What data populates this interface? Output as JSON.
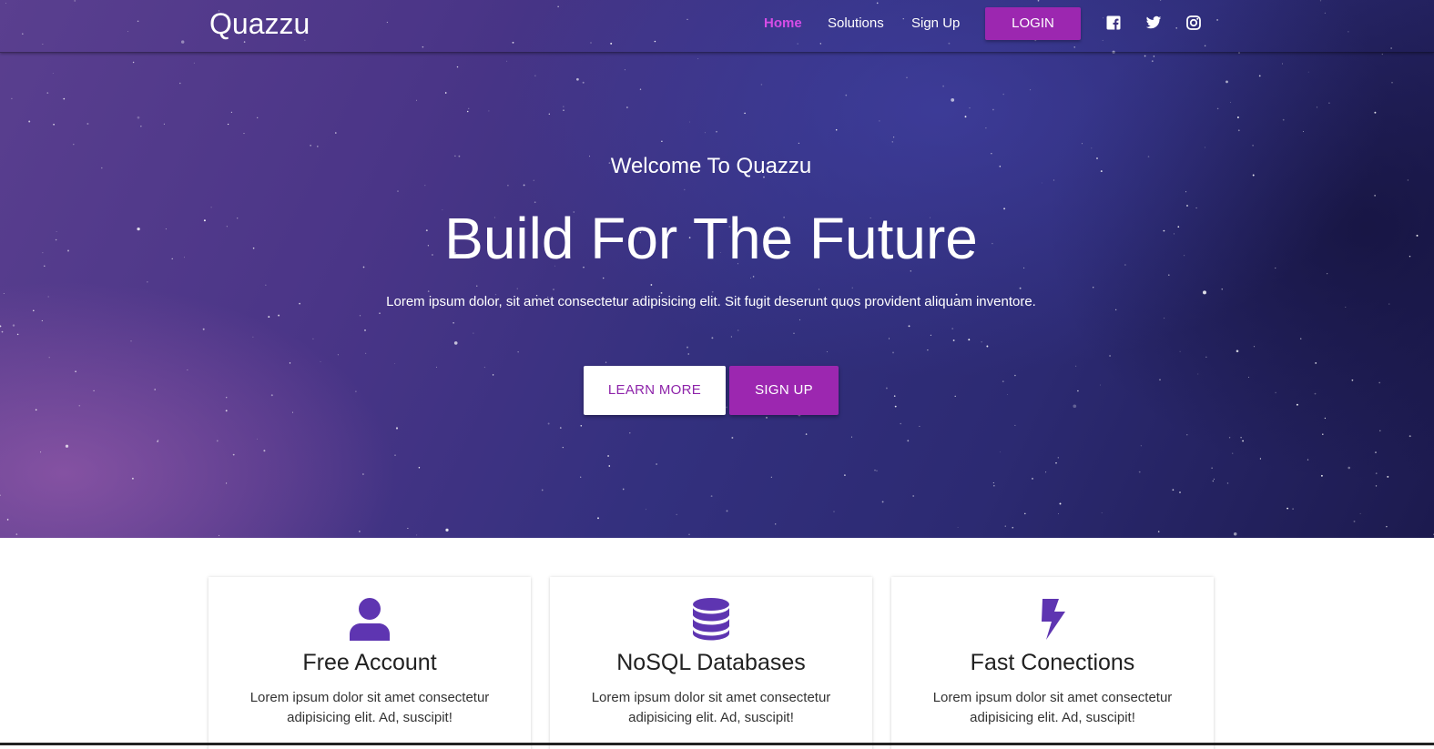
{
  "colors": {
    "accent": "#9c27b0",
    "active_nav": "#d54ce6",
    "icon": "#5e35b1",
    "hero_text": "#ffffff"
  },
  "navbar": {
    "brand": "Quazzu",
    "links": [
      {
        "label": "Home",
        "active": true
      },
      {
        "label": "Solutions",
        "active": false
      },
      {
        "label": "Sign Up",
        "active": false
      }
    ],
    "login_label": "LOGIN",
    "social_icons": [
      "facebook-icon",
      "twitter-icon",
      "instagram-icon"
    ]
  },
  "hero": {
    "welcome": "Welcome To Quazzu",
    "headline": "Build For The Future",
    "tagline": "Lorem ipsum dolor, sit amet consectetur adipisicing elit. Sit fugit deserunt quos provident aliquam inventore.",
    "learn_more_label": "LEARN MORE",
    "sign_up_label": "SIGN UP"
  },
  "features": [
    {
      "icon": "user-icon",
      "title": "Free Account",
      "text": "Lorem ipsum dolor sit amet consectetur adipisicing elit. Ad, suscipit!"
    },
    {
      "icon": "database-icon",
      "title": "NoSQL Databases",
      "text": "Lorem ipsum dolor sit amet consectetur adipisicing elit. Ad, suscipit!"
    },
    {
      "icon": "bolt-icon",
      "title": "Fast Conections",
      "text": "Lorem ipsum dolor sit amet consectetur adipisicing elit. Ad, suscipit!"
    }
  ]
}
